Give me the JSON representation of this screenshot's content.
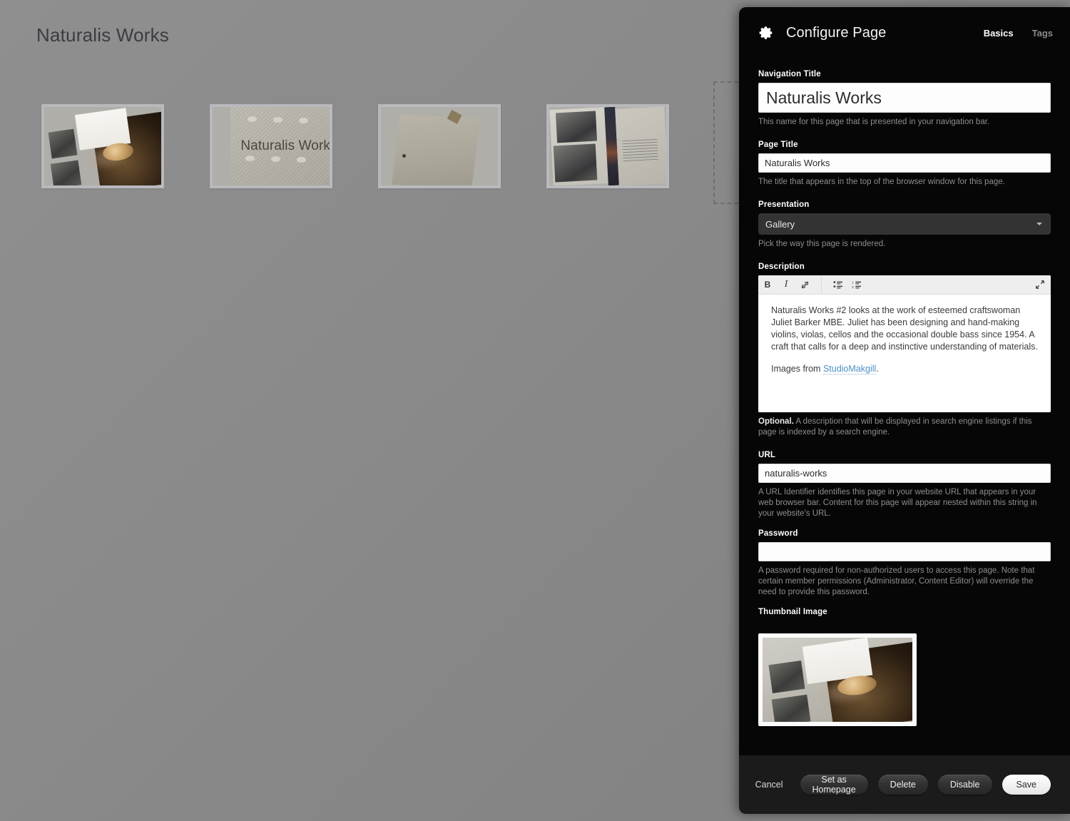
{
  "background": {
    "site_title": "Naturalis Works",
    "gallery_items": [
      {
        "name": "booklet-spread-craftsman",
        "caption": ""
      },
      {
        "name": "embossed-cover",
        "caption": "Naturalis Works"
      },
      {
        "name": "grey-card-cover",
        "caption": ""
      },
      {
        "name": "booklet-spread-photos",
        "caption": ""
      }
    ],
    "drop_placeholder_label": ""
  },
  "panel": {
    "icon": "gear-icon",
    "title": "Configure Page",
    "tabs": [
      {
        "label": "Basics",
        "active": true
      },
      {
        "label": "Tags",
        "active": false
      }
    ],
    "fields": {
      "navigation_title": {
        "label": "Navigation Title",
        "value": "Naturalis Works",
        "placeholder": "",
        "help": "This name for this page that is presented in your navigation bar."
      },
      "page_title": {
        "label": "Page Title",
        "value": "Naturalis Works",
        "placeholder": "",
        "help": "The title that appears in the top of the browser window for this page."
      },
      "presentation": {
        "label": "Presentation",
        "value": "Gallery",
        "help": "Pick the way this page is rendered.",
        "caret_icon": "chevron-down-icon"
      },
      "description": {
        "label": "Description",
        "toolbar": [
          {
            "name": "bold-icon",
            "glyph": "B"
          },
          {
            "name": "italic-icon",
            "glyph": "I"
          },
          {
            "name": "unlink-icon",
            "glyph": "⊘"
          },
          {
            "name": "bullet-list-icon",
            "glyph": "☷"
          },
          {
            "name": "numbered-list-icon",
            "glyph": "☰"
          },
          {
            "name": "expand-icon",
            "glyph": "⤡"
          }
        ],
        "paragraph_1": "Naturalis Works #2 looks at the work of esteemed craftswoman Juliet Barker MBE. Juliet has been designing and hand-making violins, violas, cellos and the occasional double bass since 1954. A craft that calls for a deep and instinctive understanding of materials.",
        "paragraph_2_prefix": "Images from ",
        "paragraph_2_link": "StudioMakgill",
        "paragraph_2_suffix": ".",
        "help_bold": "Optional.",
        "help_rest": " A description that will be displayed in search engine listings if this page is indexed by a search engine."
      },
      "url": {
        "label": "URL",
        "value": "naturalis-works",
        "placeholder": "",
        "help": "A URL Identifier identifies this page in your website URL that appears in your web browser bar. Content for this page will appear nested within this string in your website's URL."
      },
      "password": {
        "label": "Password",
        "value": "",
        "placeholder": "",
        "help": "A password required for non-authorized users to access this page. Note that certain member permissions (Administrator, Content Editor) will override the need to provide this password."
      },
      "thumbnail": {
        "label": "Thumbnail Image",
        "image_name": "booklet-spread-craftsman-thumbnail"
      }
    },
    "footer": {
      "cancel": "Cancel",
      "set_homepage": "Set as Homepage",
      "delete": "Delete",
      "disable": "Disable",
      "save": "Save"
    }
  },
  "colors": {
    "panel_bg": "#060606",
    "footer_bg": "#1b1b1b",
    "accent_link": "#4a90c4",
    "page_bg": "#8c8c8c",
    "select_bg": "#333333"
  }
}
